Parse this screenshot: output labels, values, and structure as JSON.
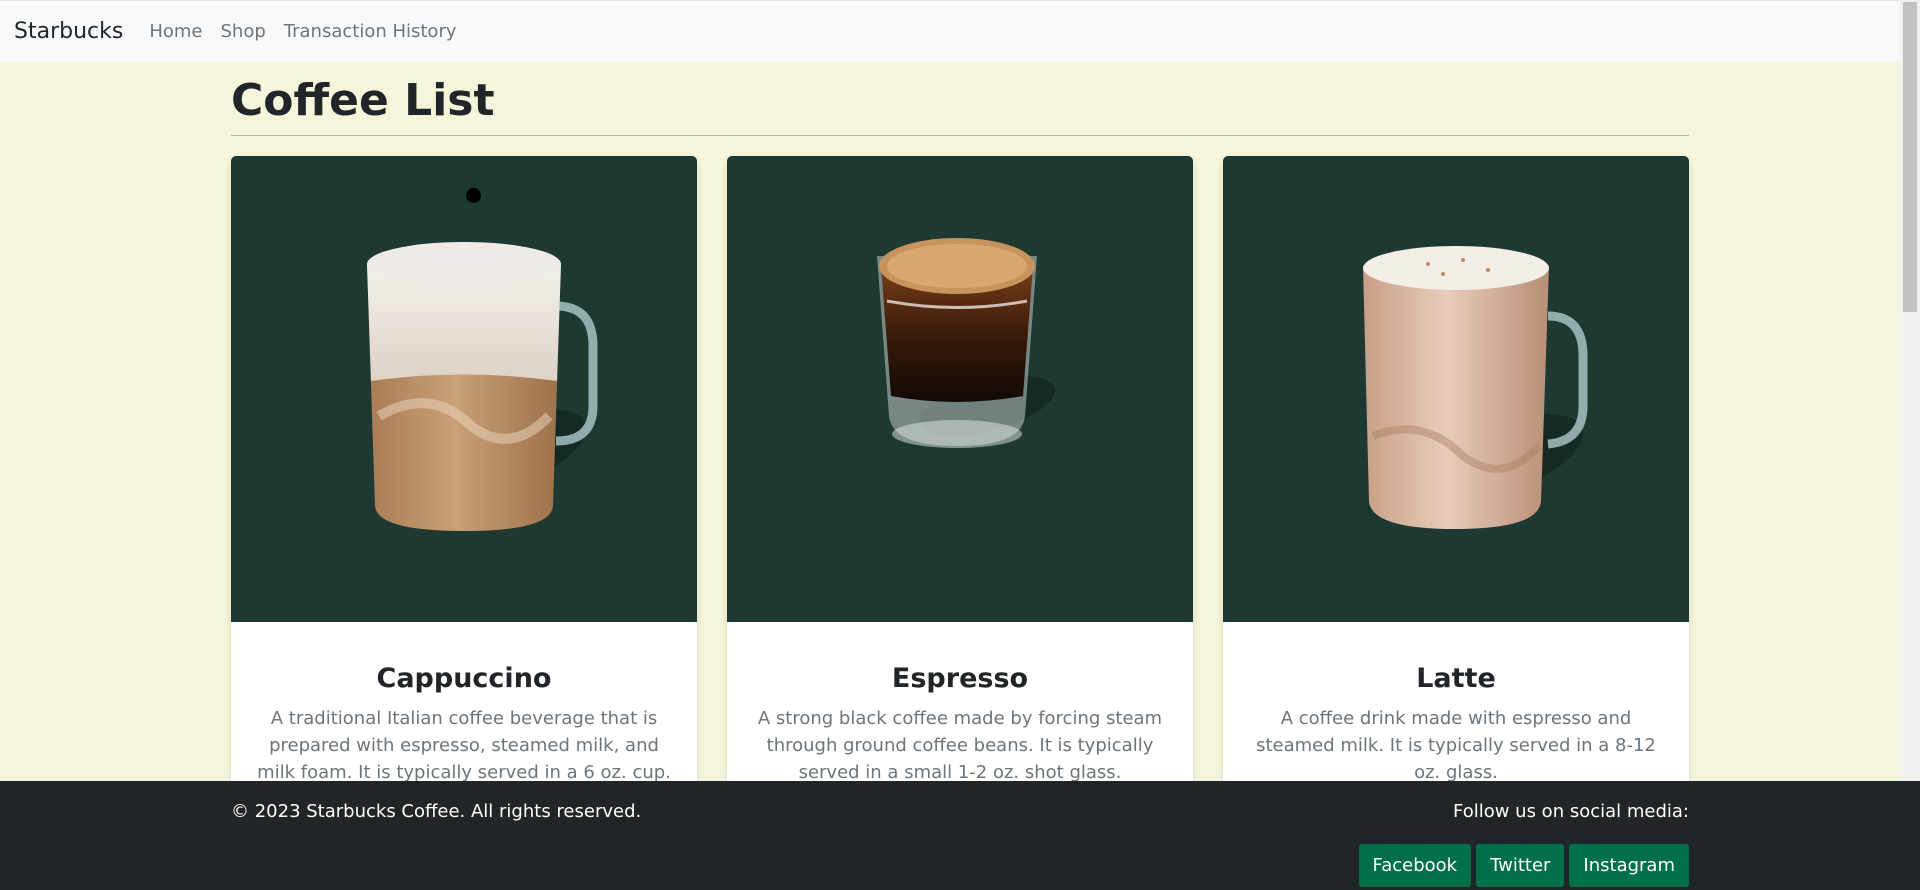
{
  "navbar": {
    "brand": "Starbucks",
    "links": [
      "Home",
      "Shop",
      "Transaction History"
    ]
  },
  "main": {
    "title": "Coffee List",
    "cards": [
      {
        "name": "Cappuccino",
        "description": "A traditional Italian coffee beverage that is prepared with espresso, steamed milk, and milk foam. It is typically served in a 6 oz. cup."
      },
      {
        "name": "Espresso",
        "description": "A strong black coffee made by forcing steam through ground coffee beans. It is typically served in a small 1-2 oz. shot glass."
      },
      {
        "name": "Latte",
        "description": "A coffee drink made with espresso and steamed milk. It is typically served in a 8-12 oz. glass."
      }
    ]
  },
  "footer": {
    "copyright": "© 2023 Starbucks Coffee. All rights reserved.",
    "follow_text": "Follow us on social media:",
    "social": [
      "Facebook",
      "Twitter",
      "Instagram"
    ]
  },
  "colors": {
    "background": "#f5f5dc",
    "card_image_bg": "#1e3932",
    "footer_bg": "#212529",
    "social_button": "#00704a"
  }
}
